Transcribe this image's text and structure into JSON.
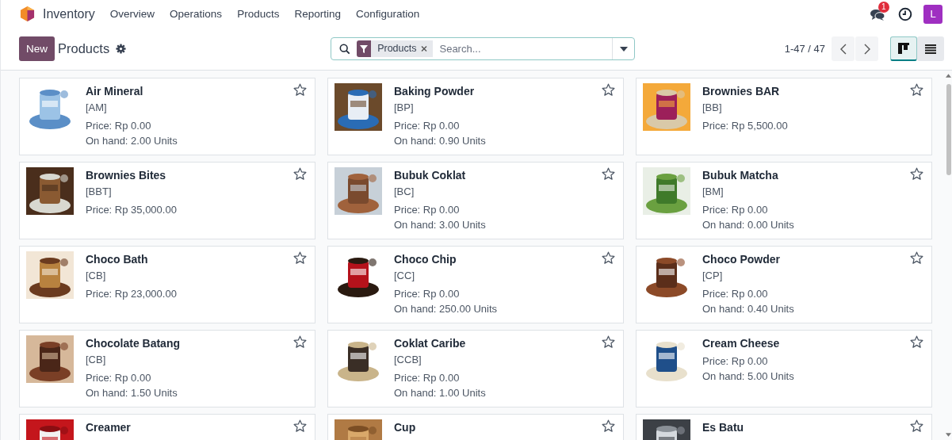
{
  "navbar": {
    "app_name": "Inventory",
    "menu": [
      "Overview",
      "Operations",
      "Products",
      "Reporting",
      "Configuration"
    ],
    "messages_badge": "1",
    "user_initial": "L"
  },
  "control_panel": {
    "new_button": "New",
    "title": "Products",
    "search": {
      "facet": "Products",
      "placeholder": "Search..."
    },
    "pager": "1-47 / 47",
    "views": [
      {
        "kind": "kanban",
        "selected": true
      },
      {
        "kind": "list",
        "selected": false
      }
    ]
  },
  "products": [
    {
      "name": "Air Mineral",
      "code": "[AM]",
      "price": "Price: Rp 0.00",
      "on_hand": "On hand: 2.00 Units",
      "favorite": false
    },
    {
      "name": "Baking Powder",
      "code": "[BP]",
      "price": "Price: Rp 0.00",
      "on_hand": "On hand: 0.90 Units",
      "favorite": false
    },
    {
      "name": "Brownies BAR",
      "code": "[BB]",
      "price": "Price: Rp 5,500.00",
      "favorite": false
    },
    {
      "name": "Brownies Bites",
      "code": "[BBT]",
      "price": "Price: Rp 35,000.00",
      "favorite": false
    },
    {
      "name": "Bubuk Coklat",
      "code": "[BC]",
      "price": "Price: Rp 0.00",
      "on_hand": "On hand: 3.00 Units",
      "favorite": false
    },
    {
      "name": "Bubuk Matcha",
      "code": "[BM]",
      "price": "Price: Rp 0.00",
      "on_hand": "On hand: 0.00 Units",
      "favorite": false
    },
    {
      "name": "Choco Bath",
      "code": "[CB]",
      "price": "Price: Rp 23,000.00",
      "favorite": false
    },
    {
      "name": "Choco Chip",
      "code": "[CC]",
      "price": "Price: Rp 0.00",
      "on_hand": "On hand: 250.00 Units",
      "favorite": false
    },
    {
      "name": "Choco Powder",
      "code": "[CP]",
      "price": "Price: Rp 0.00",
      "on_hand": "On hand: 0.40 Units",
      "favorite": false
    },
    {
      "name": "Chocolate Batang",
      "code": "[CB]",
      "price": "Price: Rp 0.00",
      "on_hand": "On hand: 1.50 Units",
      "favorite": false
    },
    {
      "name": "Coklat Caribe",
      "code": "[CCB]",
      "price": "Price: Rp 0.00",
      "on_hand": "On hand: 1.00 Units",
      "favorite": false
    },
    {
      "name": "Cream Cheese",
      "price": "Price: Rp 0.00",
      "on_hand": "On hand: 5.00 Units",
      "favorite": false
    },
    {
      "name": "Creamer",
      "favorite": false
    },
    {
      "name": "Cup",
      "favorite": false
    },
    {
      "name": "Es Batu",
      "favorite": false
    }
  ]
}
